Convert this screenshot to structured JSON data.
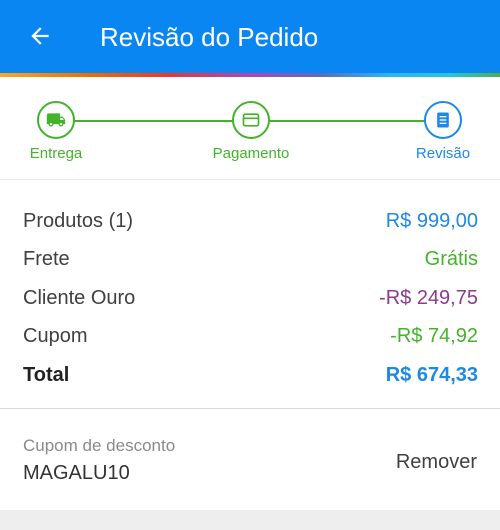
{
  "header": {
    "title": "Revisão do Pedido",
    "back_icon": "arrow-left-icon",
    "color": "#0a86f2"
  },
  "stepper": {
    "steps": [
      {
        "label": "Entrega",
        "icon": "truck-icon",
        "status": "done",
        "color": "#44b32b"
      },
      {
        "label": "Pagamento",
        "icon": "card-icon",
        "status": "done",
        "color": "#44b32b"
      },
      {
        "label": "Revisão",
        "icon": "receipt-icon",
        "status": "current",
        "color": "#1e88e5"
      }
    ]
  },
  "summary": {
    "rows": [
      {
        "label": "Produtos (1)",
        "value": "R$ 999,00",
        "color": "#1e88e5"
      },
      {
        "label": "Frete",
        "value": "Grátis",
        "color": "#44b32b"
      },
      {
        "label": "Cliente Ouro",
        "value": "-R$ 249,75",
        "color": "#8e3a8e"
      },
      {
        "label": "Cupom",
        "value": "-R$ 74,92",
        "color": "#44b32b"
      }
    ],
    "total": {
      "label": "Total",
      "value": "R$ 674,33",
      "color": "#1e88e5"
    }
  },
  "coupon": {
    "label": "Cupom de desconto",
    "code": "MAGALU10",
    "remove_label": "Remover"
  }
}
